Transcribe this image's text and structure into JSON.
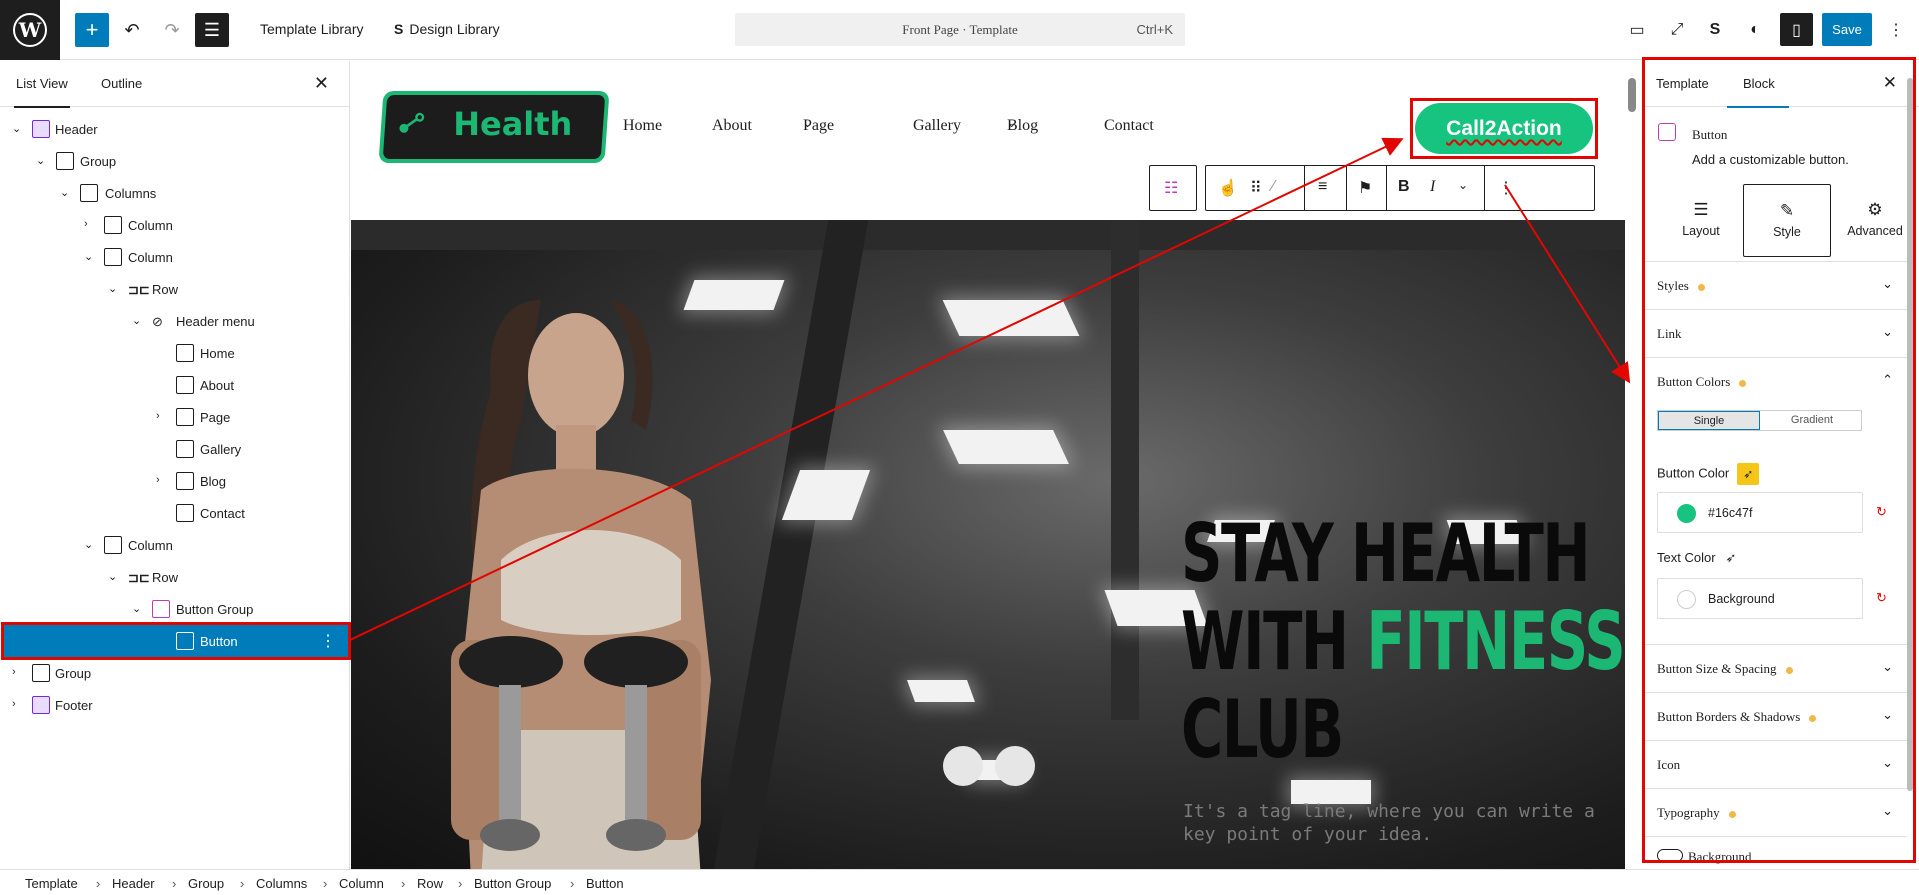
{
  "toolbar": {
    "template_library": "Template Library",
    "design_library": "Design Library",
    "command_title": "Front Page · Template",
    "command_shortcut": "Ctrl+K",
    "save_label": "Save"
  },
  "list_view": {
    "tabs": [
      "List View",
      "Outline"
    ],
    "nodes": [
      {
        "label": "Header"
      },
      {
        "label": "Group"
      },
      {
        "label": "Columns"
      },
      {
        "label": "Column"
      },
      {
        "label": "Column"
      },
      {
        "label": "Row"
      },
      {
        "label": "Header menu"
      },
      {
        "label": "Home"
      },
      {
        "label": "About"
      },
      {
        "label": "Page"
      },
      {
        "label": "Gallery"
      },
      {
        "label": "Blog"
      },
      {
        "label": "Contact"
      },
      {
        "label": "Column"
      },
      {
        "label": "Row"
      },
      {
        "label": "Button Group"
      },
      {
        "label": "Button"
      },
      {
        "label": "Group"
      },
      {
        "label": "Footer"
      }
    ]
  },
  "site": {
    "logo_text": "Health",
    "menu": [
      "Home",
      "About",
      "Page",
      "Gallery",
      "Blog",
      "Contact"
    ],
    "cta_label": "Call2Action",
    "headline_line1": "STAY HEALTH",
    "headline_line2a": "WITH",
    "headline_line2b": "FITNESS",
    "headline_line3": "CLUB",
    "tagline": "It's a tag line, where you can write a key point of your idea."
  },
  "inspector": {
    "tabs": [
      "Template",
      "Block"
    ],
    "block_name": "Button",
    "block_description": "Add a customizable button.",
    "modes": [
      "Layout",
      "Style",
      "Advanced"
    ],
    "sections": [
      "Styles",
      "Link",
      "Button Colors",
      "Button Size & Spacing",
      "Button Borders & Shadows",
      "Icon",
      "Typography",
      "Background"
    ],
    "color_modes": [
      "Single",
      "Gradient"
    ],
    "button_color_label": "Button Color",
    "button_color_value": "#16c47f",
    "text_color_label": "Text Color",
    "text_color_value": "Background",
    "accent": "#16c47f"
  },
  "breadcrumbs": [
    "Template",
    "Header",
    "Group",
    "Columns",
    "Column",
    "Row",
    "Button Group",
    "Button"
  ]
}
